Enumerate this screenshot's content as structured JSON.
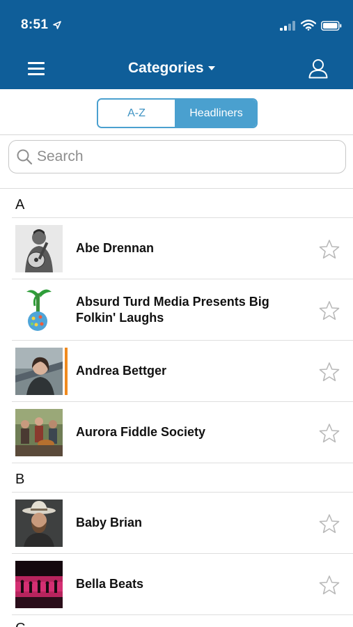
{
  "status_bar": {
    "time": "8:51"
  },
  "nav": {
    "title": "Categories"
  },
  "segments": {
    "az_label": "A-Z",
    "headliners_label": "Headliners"
  },
  "search": {
    "placeholder": "Search"
  },
  "sections": [
    {
      "letter": "A",
      "items": [
        {
          "name": "Abe Drennan"
        },
        {
          "name": "Absurd Turd Media Presents Big Folkin' Laughs"
        },
        {
          "name": "Andrea Bettger"
        },
        {
          "name": "Aurora Fiddle Society"
        }
      ]
    },
    {
      "letter": "B",
      "items": [
        {
          "name": "Baby Brian"
        },
        {
          "name": "Bella Beats"
        }
      ]
    },
    {
      "letter": "C",
      "items": []
    }
  ],
  "colors": {
    "header_bg": "#0f5e99",
    "segment_accent": "#4aa0cf",
    "row_accent": "#f08a1e"
  }
}
